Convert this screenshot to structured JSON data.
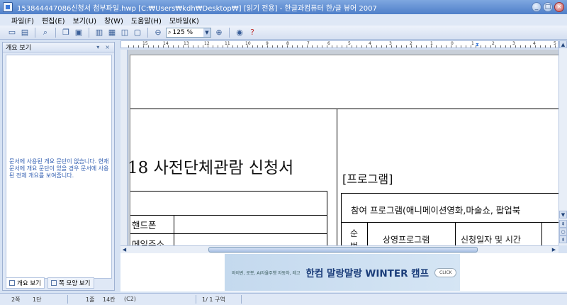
{
  "window": {
    "title": "153844447086신청서 첨부파일.hwp [C:₩Users₩kdh₩Desktop₩] [읽기 전용] - 한글과컴퓨터 한/글 뷰어 2007",
    "minimize": "_",
    "maximize": "□",
    "close": "×"
  },
  "menu": [
    "파일(F)",
    "편집(E)",
    "보기(U)",
    "창(W)",
    "도움말(H)",
    "모바일(K)"
  ],
  "toolbar": {
    "zoom_value": "125 %"
  },
  "left_pane": {
    "title": "개요 보기",
    "pin": "▾",
    "close": "×",
    "message": "문서에 사용된 개요 문단이 없습니다. 현재 문서에 개요 문단이 있을 경우 문서에 사용된 전체 개요를 보여줍니다.",
    "tabs": [
      "개요 보기",
      "쪽 모양 보기"
    ]
  },
  "ruler": {
    "numbers": [
      "15",
      "14",
      "13",
      "12",
      "11",
      "10",
      "9",
      "8",
      "7",
      "6",
      "5",
      "4",
      "3",
      "2",
      "1",
      "0",
      "1",
      "2",
      "3",
      "4",
      "5"
    ]
  },
  "document": {
    "heading": "18 사전단체관람 신청서",
    "row_phone": "핸드폰",
    "row_email": "메일주소",
    "program_heading": "[프로그램]",
    "program_title": "참여 프로그램(애니메이션영화,마술쇼, 팝업북",
    "col_no": "순번",
    "col_program": "상영프로그램",
    "col_date": "신청일자 및 시간"
  },
  "ad": {
    "small_text": "와이번, 로봇, AI자율주행 자동차, 레고",
    "big_text": "한컴 말랑말랑 WINTER 캠프",
    "click": "CLICK"
  },
  "status": {
    "page": "2쪽",
    "section": "1단",
    "line": "1줄",
    "col": "14칸",
    "mode": "(C2)",
    "pages": "1/   1 구역"
  }
}
